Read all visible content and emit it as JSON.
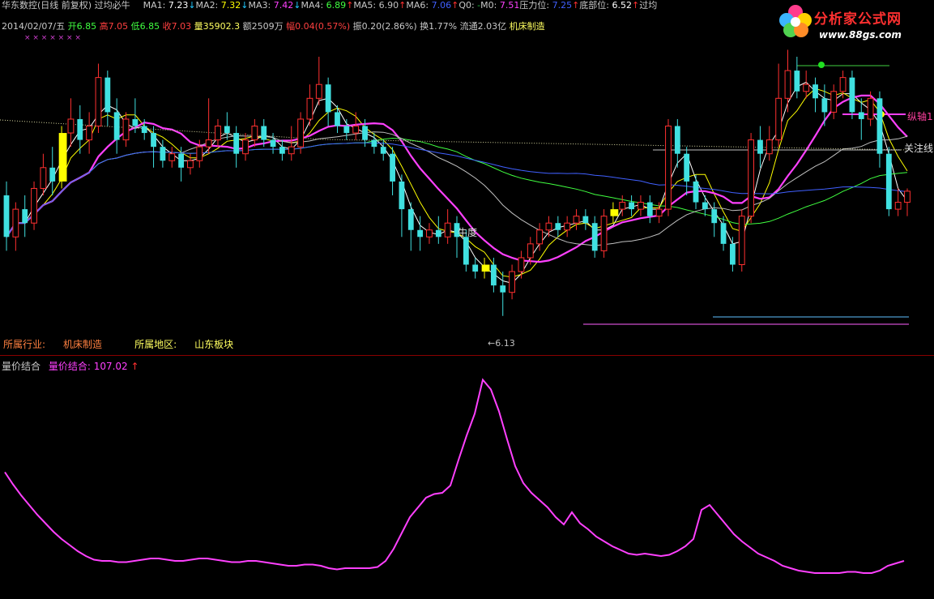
{
  "header": {
    "row1": [
      {
        "text": "华东数控(日线 前复权)",
        "color": "#c8c8c8"
      },
      {
        "text": " 过均必牛",
        "color": "#c8c8c8"
      }
    ],
    "indicators": [
      {
        "name": "MA1:",
        "value": "7.23",
        "arrow": "↓",
        "color": "#ffffff",
        "arrow_color": "#20c8ff"
      },
      {
        "name": "MA2:",
        "value": "7.32",
        "arrow": "↓",
        "color": "#ffff00",
        "arrow_color": "#20c8ff"
      },
      {
        "name": "MA3:",
        "value": "7.42",
        "arrow": "↓",
        "color": "#ff40ff",
        "arrow_color": "#20c8ff"
      },
      {
        "name": "MA4:",
        "value": "6.89",
        "arrow": "↑",
        "color": "#40ff40",
        "arrow_color": "#ff3030"
      },
      {
        "name": "MA5:",
        "value": "6.90",
        "arrow": "↑",
        "color": "#c0c0c0",
        "arrow_color": "#ff3030"
      },
      {
        "name": "MA6:",
        "value": "7.06",
        "arrow": "↑",
        "color": "#4060ff",
        "arrow_color": "#ff3030"
      },
      {
        "name": "Q0:",
        "value": "-",
        "arrow": "",
        "color": "#20c040",
        "arrow_color": "#ff3030"
      },
      {
        "name": "M0:",
        "value": "7.51",
        "arrow": "",
        "color": "#ff40ff",
        "arrow_color": "#ff3030"
      },
      {
        "name": "压力位:",
        "value": "7.25",
        "arrow": "↑",
        "color": "#4060ff",
        "arrow_color": "#ff3030"
      },
      {
        "name": "底部位:",
        "value": "6.52",
        "arrow": "↑",
        "color": "#ffffff",
        "arrow_color": "#ff3030"
      },
      {
        "name": "过均",
        "value": "",
        "arrow": "",
        "color": "#ffffff",
        "arrow_color": "#ff3030"
      }
    ],
    "row2": [
      {
        "text": "2014/02/07/五 ",
        "color": "#c8c8c8"
      },
      {
        "text": "开6.85 ",
        "color": "#40ff40"
      },
      {
        "text": "高7.05 ",
        "color": "#ff4040"
      },
      {
        "text": "低6.85 ",
        "color": "#40ff40"
      },
      {
        "text": "收7.03 ",
        "color": "#ff4040"
      },
      {
        "text": "量35902.3 ",
        "color": "#ffff60"
      },
      {
        "text": "额2509万 ",
        "color": "#c8c8c8"
      },
      {
        "text": "幅0.04(0.57%) ",
        "color": "#ff4040"
      },
      {
        "text": "振0.20(2.86%) ",
        "color": "#c8c8c8"
      },
      {
        "text": "换1.77% ",
        "color": "#c8c8c8"
      },
      {
        "text": "流通2.03亿 ",
        "color": "#c8c8c8"
      },
      {
        "text": "机床制造",
        "color": "#ffff60"
      }
    ],
    "marks": "×                                            ×                          ×  ×                               ×                                         ×                          ×"
  },
  "logo": {
    "name": "分析家公式网",
    "url": "www.88gs.com",
    "icon": "flower-logo-icon"
  },
  "industry": [
    {
      "text": "所属行业:",
      "color": "#ff8040"
    },
    {
      "text": "机床制造",
      "color": "#ff8040"
    },
    {
      "text": "所属地区:",
      "color": "#ffff60"
    },
    {
      "text": "山东板块",
      "color": "#ffff60"
    }
  ],
  "subchart": {
    "title": "量价结合",
    "title_color": "#c8c8c8",
    "label": "量价结合: 107.02",
    "arrow": "↑",
    "label_color": "#ff40ff"
  },
  "annotations": {
    "low": "←6.13",
    "niu": "牛度",
    "zongzhou": "纵轴1",
    "guanzhu": "关注线"
  },
  "colors": {
    "up": "#ff3030",
    "down": "#40e0e0",
    "yellow_bar": "#ffff00",
    "sep": "#8a0000"
  },
  "chart_data": [
    {
      "type": "candlestick",
      "title": "华东数控(日线 前复权)",
      "ylim": [
        6.0,
        8.0
      ],
      "candles": [
        [
          7.0,
          6.7,
          7.1,
          6.6
        ],
        [
          6.7,
          6.9,
          6.95,
          6.6
        ],
        [
          6.9,
          6.8,
          7.0,
          6.7
        ],
        [
          6.8,
          7.05,
          7.1,
          6.75
        ],
        [
          7.05,
          7.2,
          7.3,
          7.0
        ],
        [
          7.2,
          7.1,
          7.35,
          7.0
        ],
        [
          7.1,
          7.45,
          7.5,
          7.05
        ],
        [
          7.45,
          7.55,
          7.7,
          7.35
        ],
        [
          7.55,
          7.4,
          7.65,
          7.3
        ],
        [
          7.4,
          7.5,
          7.6,
          7.3
        ],
        [
          7.5,
          7.85,
          7.95,
          7.45
        ],
        [
          7.85,
          7.6,
          7.9,
          7.5
        ],
        [
          7.6,
          7.4,
          7.7,
          7.3
        ],
        [
          7.4,
          7.55,
          7.6,
          7.35
        ],
        [
          7.55,
          7.5,
          7.7,
          7.45
        ],
        [
          7.5,
          7.45,
          7.55,
          7.4
        ],
        [
          7.45,
          7.35,
          7.5,
          7.2
        ],
        [
          7.35,
          7.25,
          7.4,
          7.2
        ],
        [
          7.25,
          7.3,
          7.35,
          7.2
        ],
        [
          7.3,
          7.2,
          7.35,
          7.1
        ],
        [
          7.2,
          7.25,
          7.3,
          7.15
        ],
        [
          7.25,
          7.35,
          7.4,
          7.2
        ],
        [
          7.35,
          7.4,
          7.7,
          7.3
        ],
        [
          7.4,
          7.5,
          7.55,
          7.35
        ],
        [
          7.5,
          7.45,
          7.6,
          7.4
        ],
        [
          7.45,
          7.3,
          7.5,
          7.2
        ],
        [
          7.3,
          7.4,
          7.45,
          7.25
        ],
        [
          7.4,
          7.5,
          7.55,
          7.35
        ],
        [
          7.5,
          7.4,
          7.55,
          7.35
        ],
        [
          7.4,
          7.35,
          7.45,
          7.3
        ],
        [
          7.35,
          7.3,
          7.4,
          7.25
        ],
        [
          7.3,
          7.35,
          7.5,
          7.25
        ],
        [
          7.35,
          7.55,
          7.6,
          7.3
        ],
        [
          7.55,
          7.7,
          7.8,
          7.5
        ],
        [
          7.7,
          7.8,
          8.0,
          7.65
        ],
        [
          7.8,
          7.6,
          7.85,
          7.5
        ],
        [
          7.6,
          7.5,
          7.65,
          7.45
        ],
        [
          7.5,
          7.45,
          7.55,
          7.4
        ],
        [
          7.45,
          7.5,
          7.6,
          7.4
        ],
        [
          7.5,
          7.4,
          7.55,
          7.35
        ],
        [
          7.4,
          7.35,
          7.45,
          7.3
        ],
        [
          7.35,
          7.3,
          7.4,
          7.25
        ],
        [
          7.3,
          7.1,
          7.35,
          7.0
        ],
        [
          7.1,
          6.9,
          7.15,
          6.7
        ],
        [
          6.9,
          6.75,
          6.95,
          6.6
        ],
        [
          6.75,
          6.7,
          6.85,
          6.6
        ],
        [
          6.7,
          6.75,
          6.8,
          6.65
        ],
        [
          6.75,
          6.7,
          6.85,
          6.65
        ],
        [
          6.7,
          6.8,
          6.9,
          6.65
        ],
        [
          6.8,
          6.7,
          6.85,
          6.55
        ],
        [
          6.7,
          6.5,
          6.75,
          6.45
        ],
        [
          6.5,
          6.45,
          6.55,
          6.4
        ],
        [
          6.45,
          6.5,
          6.55,
          6.4
        ],
        [
          6.5,
          6.35,
          6.55,
          6.3
        ],
        [
          6.35,
          6.3,
          6.45,
          6.13
        ],
        [
          6.3,
          6.45,
          6.5,
          6.25
        ],
        [
          6.45,
          6.55,
          6.6,
          6.4
        ],
        [
          6.55,
          6.65,
          6.7,
          6.5
        ],
        [
          6.65,
          6.75,
          6.8,
          6.6
        ],
        [
          6.75,
          6.8,
          6.85,
          6.7
        ],
        [
          6.8,
          6.75,
          6.85,
          6.7
        ],
        [
          6.75,
          6.8,
          6.85,
          6.7
        ],
        [
          6.8,
          6.85,
          6.9,
          6.75
        ],
        [
          6.85,
          6.8,
          6.9,
          6.75
        ],
        [
          6.8,
          6.6,
          6.85,
          6.55
        ],
        [
          6.6,
          6.85,
          6.9,
          6.55
        ],
        [
          6.85,
          6.9,
          6.95,
          6.8
        ],
        [
          6.9,
          6.95,
          7.0,
          6.85
        ],
        [
          6.95,
          6.9,
          7.0,
          6.85
        ],
        [
          6.9,
          6.95,
          7.0,
          6.85
        ],
        [
          6.95,
          6.85,
          7.0,
          6.8
        ],
        [
          6.85,
          6.9,
          6.95,
          6.8
        ],
        [
          6.9,
          7.5,
          7.55,
          6.85
        ],
        [
          7.5,
          7.3,
          7.55,
          7.2
        ],
        [
          7.3,
          7.1,
          7.35,
          7.0
        ],
        [
          7.1,
          6.95,
          7.15,
          6.9
        ],
        [
          6.95,
          6.9,
          7.0,
          6.85
        ],
        [
          6.9,
          6.8,
          6.95,
          6.7
        ],
        [
          6.8,
          6.65,
          6.85,
          6.6
        ],
        [
          6.65,
          6.5,
          6.7,
          6.45
        ],
        [
          6.5,
          6.85,
          6.9,
          6.45
        ],
        [
          6.85,
          7.4,
          7.45,
          6.8
        ],
        [
          7.4,
          7.3,
          7.5,
          7.2
        ],
        [
          7.3,
          7.4,
          7.5,
          7.25
        ],
        [
          7.4,
          7.7,
          7.95,
          7.35
        ],
        [
          7.7,
          7.9,
          8.05,
          7.6
        ],
        [
          7.9,
          7.75,
          8.0,
          7.7
        ],
        [
          7.75,
          7.8,
          7.9,
          7.7
        ],
        [
          7.8,
          7.7,
          7.85,
          7.6
        ],
        [
          7.7,
          7.6,
          7.8,
          7.5
        ],
        [
          7.6,
          7.75,
          7.8,
          7.55
        ],
        [
          7.75,
          7.85,
          7.9,
          7.7
        ],
        [
          7.85,
          7.6,
          7.9,
          7.55
        ],
        [
          7.6,
          7.55,
          7.7,
          7.4
        ],
        [
          7.55,
          7.7,
          7.75,
          7.5
        ],
        [
          7.7,
          7.3,
          7.75,
          7.2
        ],
        [
          7.3,
          6.9,
          7.35,
          6.85
        ],
        [
          6.9,
          6.95,
          7.05,
          6.85
        ],
        [
          6.95,
          7.03,
          7.05,
          6.85
        ]
      ],
      "yellow_bars": [
        6,
        52,
        66
      ],
      "ma_series": [
        {
          "name": "MA1",
          "color": "#ffffff"
        },
        {
          "name": "MA2",
          "color": "#ffff00"
        },
        {
          "name": "MA3",
          "color": "#ff40ff"
        },
        {
          "name": "MA4",
          "color": "#40ff40"
        },
        {
          "name": "MA5",
          "color": "#c0c0c0"
        },
        {
          "name": "MA6",
          "color": "#4060ff"
        }
      ],
      "low_value": 6.13
    },
    {
      "type": "line",
      "title": "量价结合",
      "series": [
        {
          "name": "量价结合",
          "color": "#ff40ff"
        }
      ],
      "x": [
        0,
        10,
        20,
        30,
        40,
        50,
        60,
        70,
        80,
        90,
        100,
        110,
        120,
        130,
        140,
        150,
        160,
        170,
        180,
        190,
        200,
        210,
        220,
        230,
        240,
        250,
        260,
        270,
        280,
        290,
        300,
        310,
        320,
        330,
        340,
        350,
        360,
        370,
        380,
        390,
        400,
        410,
        420,
        430,
        440,
        450,
        460,
        470,
        480,
        490,
        500,
        510,
        520,
        530,
        540,
        550,
        560,
        570,
        580,
        590,
        600,
        610,
        620,
        630,
        640,
        650,
        660,
        670,
        680,
        690,
        700,
        710,
        720,
        730,
        740,
        750,
        760,
        770,
        780,
        790,
        800,
        810,
        820,
        830,
        840,
        850,
        860,
        870,
        880,
        890,
        900,
        910,
        920,
        930,
        940,
        950,
        960,
        970,
        980,
        990,
        1000,
        1010,
        1020,
        1030,
        1040,
        1050,
        1060,
        1070,
        1080,
        1090,
        1100,
        1110
      ],
      "values": [
        95,
        85,
        76,
        68,
        60,
        53,
        46,
        40,
        35,
        30,
        26,
        23,
        22,
        22,
        21,
        21,
        22,
        23,
        24,
        24,
        23,
        22,
        22,
        23,
        24,
        24,
        23,
        22,
        21,
        21,
        22,
        22,
        21,
        20,
        19,
        18,
        18,
        19,
        19,
        18,
        16,
        15,
        16,
        16,
        16,
        16,
        17,
        22,
        32,
        45,
        58,
        66,
        74,
        77,
        78,
        84,
        105,
        125,
        143,
        171,
        163,
        145,
        122,
        100,
        86,
        78,
        72,
        66,
        58,
        52,
        62,
        53,
        48,
        42,
        38,
        34,
        31,
        28,
        27,
        28,
        27,
        26,
        27,
        30,
        34,
        40,
        64,
        68,
        60,
        52,
        44,
        38,
        33,
        28,
        25,
        22,
        18,
        16,
        14,
        13,
        12,
        12,
        12,
        12,
        13,
        13,
        12,
        12,
        14,
        18,
        20,
        22
      ]
    }
  ]
}
